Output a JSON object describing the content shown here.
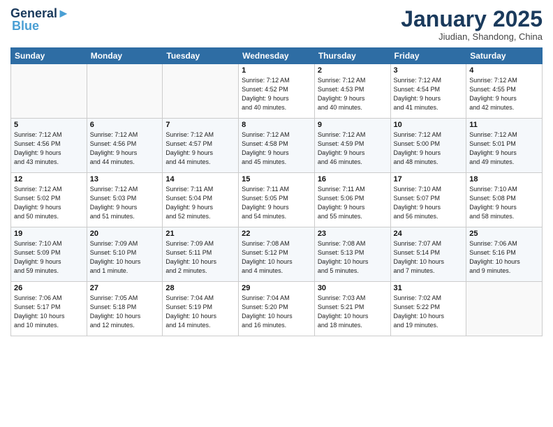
{
  "logo": {
    "line1": "General",
    "line2": "Blue"
  },
  "title": "January 2025",
  "subtitle": "Jiudian, Shandong, China",
  "days_of_week": [
    "Sunday",
    "Monday",
    "Tuesday",
    "Wednesday",
    "Thursday",
    "Friday",
    "Saturday"
  ],
  "weeks": [
    [
      {
        "num": "",
        "info": ""
      },
      {
        "num": "",
        "info": ""
      },
      {
        "num": "",
        "info": ""
      },
      {
        "num": "1",
        "info": "Sunrise: 7:12 AM\nSunset: 4:52 PM\nDaylight: 9 hours\nand 40 minutes."
      },
      {
        "num": "2",
        "info": "Sunrise: 7:12 AM\nSunset: 4:53 PM\nDaylight: 9 hours\nand 40 minutes."
      },
      {
        "num": "3",
        "info": "Sunrise: 7:12 AM\nSunset: 4:54 PM\nDaylight: 9 hours\nand 41 minutes."
      },
      {
        "num": "4",
        "info": "Sunrise: 7:12 AM\nSunset: 4:55 PM\nDaylight: 9 hours\nand 42 minutes."
      }
    ],
    [
      {
        "num": "5",
        "info": "Sunrise: 7:12 AM\nSunset: 4:56 PM\nDaylight: 9 hours\nand 43 minutes."
      },
      {
        "num": "6",
        "info": "Sunrise: 7:12 AM\nSunset: 4:56 PM\nDaylight: 9 hours\nand 44 minutes."
      },
      {
        "num": "7",
        "info": "Sunrise: 7:12 AM\nSunset: 4:57 PM\nDaylight: 9 hours\nand 44 minutes."
      },
      {
        "num": "8",
        "info": "Sunrise: 7:12 AM\nSunset: 4:58 PM\nDaylight: 9 hours\nand 45 minutes."
      },
      {
        "num": "9",
        "info": "Sunrise: 7:12 AM\nSunset: 4:59 PM\nDaylight: 9 hours\nand 46 minutes."
      },
      {
        "num": "10",
        "info": "Sunrise: 7:12 AM\nSunset: 5:00 PM\nDaylight: 9 hours\nand 48 minutes."
      },
      {
        "num": "11",
        "info": "Sunrise: 7:12 AM\nSunset: 5:01 PM\nDaylight: 9 hours\nand 49 minutes."
      }
    ],
    [
      {
        "num": "12",
        "info": "Sunrise: 7:12 AM\nSunset: 5:02 PM\nDaylight: 9 hours\nand 50 minutes."
      },
      {
        "num": "13",
        "info": "Sunrise: 7:12 AM\nSunset: 5:03 PM\nDaylight: 9 hours\nand 51 minutes."
      },
      {
        "num": "14",
        "info": "Sunrise: 7:11 AM\nSunset: 5:04 PM\nDaylight: 9 hours\nand 52 minutes."
      },
      {
        "num": "15",
        "info": "Sunrise: 7:11 AM\nSunset: 5:05 PM\nDaylight: 9 hours\nand 54 minutes."
      },
      {
        "num": "16",
        "info": "Sunrise: 7:11 AM\nSunset: 5:06 PM\nDaylight: 9 hours\nand 55 minutes."
      },
      {
        "num": "17",
        "info": "Sunrise: 7:10 AM\nSunset: 5:07 PM\nDaylight: 9 hours\nand 56 minutes."
      },
      {
        "num": "18",
        "info": "Sunrise: 7:10 AM\nSunset: 5:08 PM\nDaylight: 9 hours\nand 58 minutes."
      }
    ],
    [
      {
        "num": "19",
        "info": "Sunrise: 7:10 AM\nSunset: 5:09 PM\nDaylight: 9 hours\nand 59 minutes."
      },
      {
        "num": "20",
        "info": "Sunrise: 7:09 AM\nSunset: 5:10 PM\nDaylight: 10 hours\nand 1 minute."
      },
      {
        "num": "21",
        "info": "Sunrise: 7:09 AM\nSunset: 5:11 PM\nDaylight: 10 hours\nand 2 minutes."
      },
      {
        "num": "22",
        "info": "Sunrise: 7:08 AM\nSunset: 5:12 PM\nDaylight: 10 hours\nand 4 minutes."
      },
      {
        "num": "23",
        "info": "Sunrise: 7:08 AM\nSunset: 5:13 PM\nDaylight: 10 hours\nand 5 minutes."
      },
      {
        "num": "24",
        "info": "Sunrise: 7:07 AM\nSunset: 5:14 PM\nDaylight: 10 hours\nand 7 minutes."
      },
      {
        "num": "25",
        "info": "Sunrise: 7:06 AM\nSunset: 5:16 PM\nDaylight: 10 hours\nand 9 minutes."
      }
    ],
    [
      {
        "num": "26",
        "info": "Sunrise: 7:06 AM\nSunset: 5:17 PM\nDaylight: 10 hours\nand 10 minutes."
      },
      {
        "num": "27",
        "info": "Sunrise: 7:05 AM\nSunset: 5:18 PM\nDaylight: 10 hours\nand 12 minutes."
      },
      {
        "num": "28",
        "info": "Sunrise: 7:04 AM\nSunset: 5:19 PM\nDaylight: 10 hours\nand 14 minutes."
      },
      {
        "num": "29",
        "info": "Sunrise: 7:04 AM\nSunset: 5:20 PM\nDaylight: 10 hours\nand 16 minutes."
      },
      {
        "num": "30",
        "info": "Sunrise: 7:03 AM\nSunset: 5:21 PM\nDaylight: 10 hours\nand 18 minutes."
      },
      {
        "num": "31",
        "info": "Sunrise: 7:02 AM\nSunset: 5:22 PM\nDaylight: 10 hours\nand 19 minutes."
      },
      {
        "num": "",
        "info": ""
      }
    ]
  ]
}
